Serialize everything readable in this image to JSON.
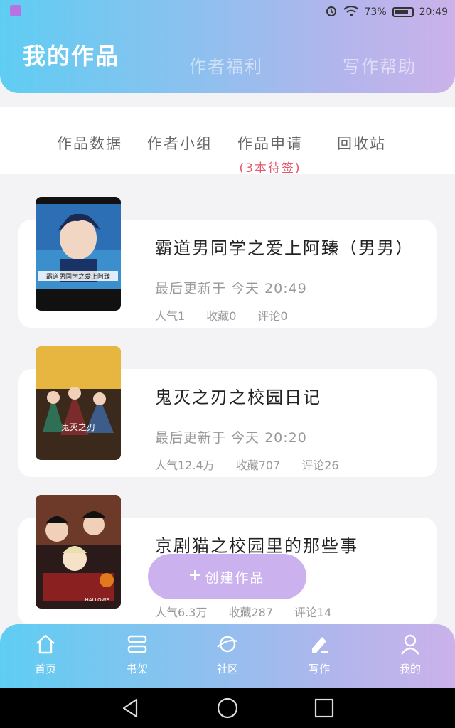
{
  "status_bar": {
    "battery": "73%",
    "time": "20:49",
    "icons": [
      "app-icon",
      "alarm-icon",
      "wifi-icon",
      "battery-icon"
    ]
  },
  "header_tabs": [
    {
      "label": "我的作品",
      "active": true
    },
    {
      "label": "作者福利",
      "active": false
    },
    {
      "label": "写作帮助",
      "active": false
    }
  ],
  "subnav": [
    {
      "label": "作品数据"
    },
    {
      "label": "作者小组"
    },
    {
      "label": "作品申请",
      "sub": "(3本待签)"
    },
    {
      "label": "回收站"
    }
  ],
  "works": [
    {
      "title": "霸道男同学之爱上阿臻（男男）",
      "updated": "最后更新于 今天 20:49",
      "stats": [
        "人气1",
        "收藏0",
        "评论0"
      ],
      "cover_caption": "霸道男同学之爱上阿臻"
    },
    {
      "title": "鬼灭之刃之校园日记",
      "updated": "最后更新于 今天 20:20",
      "stats": [
        "人气12.4万",
        "收藏707",
        "评论26"
      ],
      "cover_caption": "鬼灭之刃"
    },
    {
      "title": "京剧猫之校园里的那些事",
      "updated": "",
      "stats": [
        "人气6.3万",
        "收藏287",
        "评论14"
      ],
      "cover_caption": "HALLOWE"
    }
  ],
  "create_button": {
    "label": "创建作品",
    "icon": "plus-icon"
  },
  "bottom_nav": [
    {
      "label": "首页",
      "icon": "home-icon"
    },
    {
      "label": "书架",
      "icon": "bookshelf-icon"
    },
    {
      "label": "社区",
      "icon": "planet-icon"
    },
    {
      "label": "写作",
      "icon": "pen-icon",
      "active": true
    },
    {
      "label": "我的",
      "icon": "person-icon"
    }
  ],
  "colors": {
    "gradient_start": "#5fcdf2",
    "gradient_end": "#cbb2ea",
    "accent": "#cbb1ed",
    "pending_text": "#e5556b"
  }
}
